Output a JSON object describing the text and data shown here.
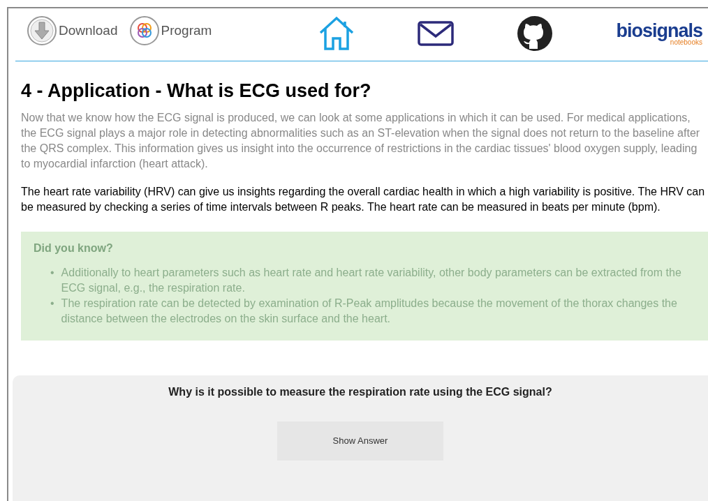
{
  "header": {
    "links": [
      {
        "kind": "download",
        "label": "Download"
      },
      {
        "kind": "program",
        "label": "Program"
      }
    ],
    "logo": {
      "wordmark": "biosignals",
      "tagline": "notebooks"
    }
  },
  "section": {
    "title": "4 - Application - What is ECG used for?",
    "paragraphs": [
      {
        "text": "Now that we know how the ECG signal is produced, we can look at some applications in which it can be used. For medical applications, the ECG signal plays a major role in detecting abnormalities such as an ST-elevation when the signal does not return to the baseline after the QRS complex. This information gives us insight into the occurrence of restrictions in the cardiac tissues' blood oxygen supply, leading to myocardial infarction (heart attack).",
        "blurred": true
      },
      {
        "text": "The heart rate variability (HRV) can give us insights regarding the overall cardiac health in which a high variability is positive. The HRV can be measured by checking a series of time intervals between R peaks. The heart rate can be measured in beats per minute (bpm).",
        "blurred": false
      }
    ],
    "info_box": {
      "title": "Did you know?",
      "blurred": true,
      "bullet": "•",
      "items": [
        "Additionally to heart parameters such as heart rate and heart rate variability, other body parameters can be extracted from the ECG signal, e.g., the respiration rate.",
        "The respiration rate can be detected by examination of R-Peak amplitudes because the movement of the thorax changes the distance between the electrodes on the skin surface and the heart."
      ]
    }
  },
  "quiz": {
    "question": "Why is it possible to measure the respiration rate using the ECG signal?",
    "button": "Show Answer"
  }
}
